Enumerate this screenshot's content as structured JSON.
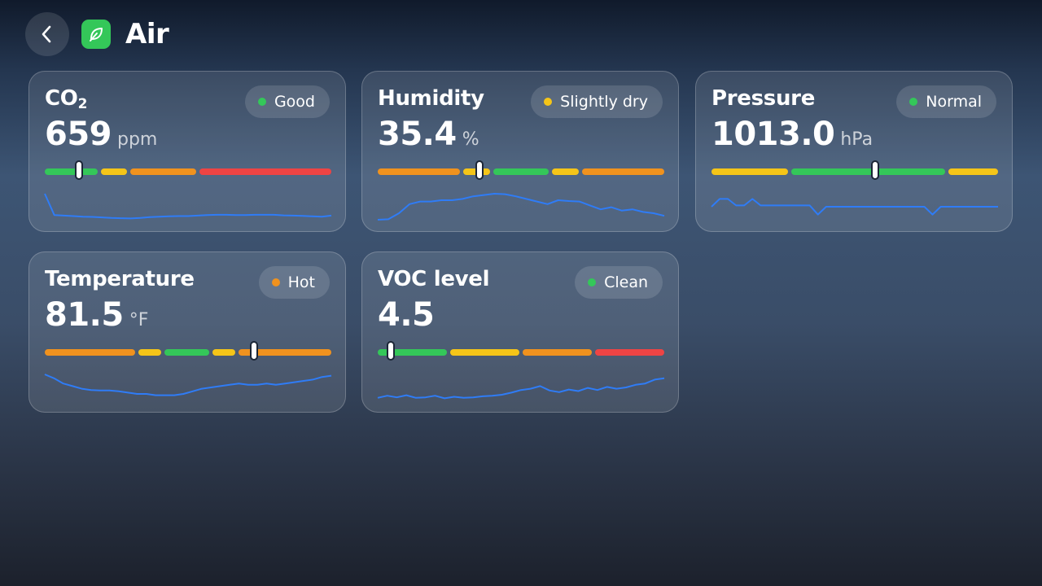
{
  "header": {
    "back_icon": "chevron-left-icon",
    "app_icon": "leaf-icon",
    "app_icon_color": "#34c759",
    "title": "Air"
  },
  "colors": {
    "green": "#34c759",
    "yellow": "#f5c518",
    "orange": "#f0921e",
    "red": "#ee4444",
    "spark": "#2f7cf6"
  },
  "cards": [
    {
      "title": "CO",
      "title_sub": "2",
      "value": "659",
      "unit": "ppm",
      "status": "Good",
      "status_color": "#34c759",
      "scale": {
        "segments": [
          {
            "color": "green",
            "weight": 2
          },
          {
            "color": "yellow",
            "weight": 1
          },
          {
            "color": "orange",
            "weight": 2.5
          },
          {
            "color": "red",
            "weight": 5
          }
        ],
        "marker": 0.12
      },
      "sparkline": [
        100,
        18,
        16,
        14,
        12,
        11,
        9,
        7,
        6,
        5,
        7,
        10,
        12,
        13,
        14,
        14,
        16,
        18,
        19,
        19,
        18,
        18,
        19,
        19,
        19,
        17,
        16,
        15,
        13,
        12,
        16
      ]
    },
    {
      "title": "Humidity",
      "value": "35.4",
      "unit": "%",
      "status": "Slightly dry",
      "status_color": "#f5c518",
      "scale": {
        "segments": [
          {
            "color": "orange",
            "weight": 3
          },
          {
            "color": "yellow",
            "weight": 1
          },
          {
            "color": "green",
            "weight": 2
          },
          {
            "color": "yellow",
            "weight": 1
          },
          {
            "color": "orange",
            "weight": 3
          }
        ],
        "marker": 0.354
      },
      "sparkline": [
        0,
        2,
        25,
        60,
        70,
        70,
        75,
        75,
        80,
        90,
        95,
        100,
        98,
        90,
        80,
        70,
        60,
        75,
        72,
        70,
        55,
        40,
        48,
        35,
        40,
        30,
        25,
        15
      ]
    },
    {
      "title": "Pressure",
      "value": "1013.0",
      "unit": "hPa",
      "status": "Normal",
      "status_color": "#34c759",
      "scale": {
        "segments": [
          {
            "color": "yellow",
            "weight": 2
          },
          {
            "color": "green",
            "weight": 4
          },
          {
            "color": "yellow",
            "weight": 1.3
          }
        ],
        "marker": 0.57
      },
      "sparkline": [
        50,
        80,
        80,
        55,
        55,
        80,
        55,
        55,
        55,
        55,
        55,
        55,
        55,
        20,
        50,
        50,
        50,
        50,
        50,
        50,
        50,
        50,
        50,
        50,
        50,
        50,
        50,
        20,
        50,
        50,
        50,
        50,
        50,
        50,
        50,
        50
      ]
    },
    {
      "title": "Temperature",
      "value": "81.5",
      "unit": "°F",
      "status": "Hot",
      "status_color": "#f0921e",
      "scale": {
        "segments": [
          {
            "color": "orange",
            "weight": 3.2
          },
          {
            "color": "yellow",
            "weight": 0.8
          },
          {
            "color": "green",
            "weight": 1.6
          },
          {
            "color": "yellow",
            "weight": 0.8
          },
          {
            "color": "orange",
            "weight": 3.3
          }
        ],
        "marker": 0.73
      },
      "sparkline": [
        100,
        85,
        65,
        55,
        45,
        40,
        38,
        38,
        35,
        30,
        25,
        25,
        20,
        20,
        20,
        25,
        35,
        45,
        50,
        55,
        60,
        65,
        60,
        60,
        65,
        60,
        65,
        70,
        75,
        80,
        90,
        95
      ]
    },
    {
      "title": "VOC level",
      "value": "4.5",
      "unit": "",
      "status": "Clean",
      "status_color": "#34c759",
      "scale": {
        "segments": [
          {
            "color": "green",
            "weight": 2.5
          },
          {
            "color": "yellow",
            "weight": 2.5
          },
          {
            "color": "orange",
            "weight": 2.5
          },
          {
            "color": "red",
            "weight": 2.5
          }
        ],
        "marker": 0.045
      },
      "sparkline": [
        10,
        18,
        12,
        20,
        10,
        12,
        18,
        8,
        14,
        10,
        12,
        16,
        18,
        22,
        30,
        40,
        45,
        55,
        38,
        32,
        42,
        36,
        48,
        40,
        52,
        45,
        50,
        60,
        65,
        80,
        85
      ]
    }
  ]
}
